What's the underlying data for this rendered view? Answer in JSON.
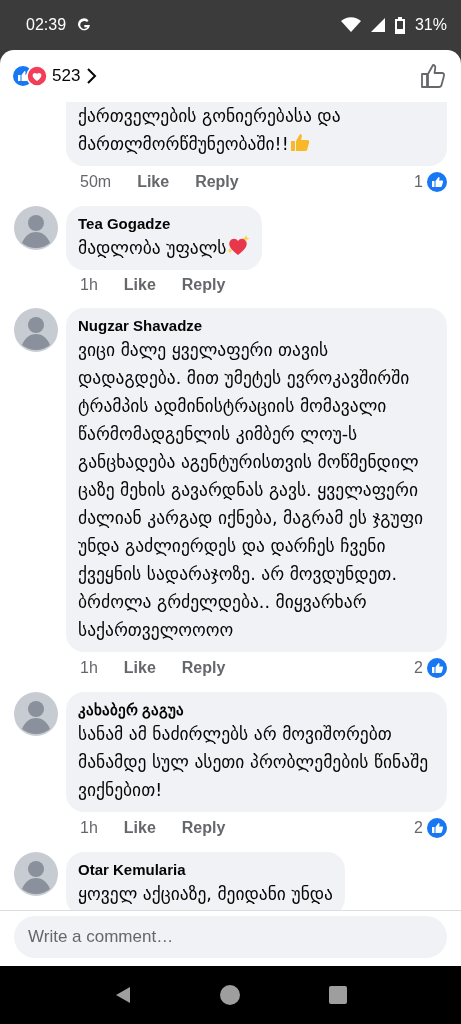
{
  "status_bar": {
    "time": "02:39",
    "battery": "31%"
  },
  "header": {
    "reaction_count": "523"
  },
  "comments": [
    {
      "lines": [
        "ქართველების გონიერებასა და",
        "მართლმორწმუნეობაში!!"
      ],
      "kind": "thumb",
      "time": "50m",
      "like": "Like",
      "reply": "Reply",
      "like_count": "1"
    },
    {
      "author": "Tea Gogadze",
      "lines": [
        "მადლობა უფალს"
      ],
      "kind": "heart",
      "time": "1h",
      "like": "Like",
      "reply": "Reply"
    },
    {
      "author": "Nugzar Shavadze",
      "lines": [
        "ვიცი მალე ყველაფერი თავის დადაგდება. მით უმეტეს ევროკავშირში ტრამპის ადმინისტრაციის მომავალი წარმომადგენლის კიმბერ ლოუ-ს განცხადება აგენტურისთვის მოწმენდილ ცაზე მეხის გავარდნას გავს. ყველაფერი ძალიან კარგად იქნება, მაგრამ  ეს ჯგუფი უნდა გაძლიერდეს და დარჩეს ჩვენი ქვეყნის სადარაჯოზე. არ მოვდუნდეთ. ბრძოლა გრძელდება.. მიყვარხარ საქართველოოოო"
      ],
      "time": "1h",
      "like": "Like",
      "reply": "Reply",
      "like_count": "2"
    },
    {
      "author": "კახაბერ გაგუა",
      "lines": [
        "სანამ ამ ნაძირლებს არ მოვიშორებთ მანამდე სულ ასეთი პრობლემების წინაშე ვიქნებით!"
      ],
      "time": "1h",
      "like": "Like",
      "reply": "Reply",
      "like_count": "2"
    },
    {
      "author": "Otar Kemularia",
      "lines": [
        "ყოველ აქციაზე, მეიდანი უნდა"
      ]
    }
  ],
  "composer": {
    "placeholder": "Write a comment…"
  }
}
